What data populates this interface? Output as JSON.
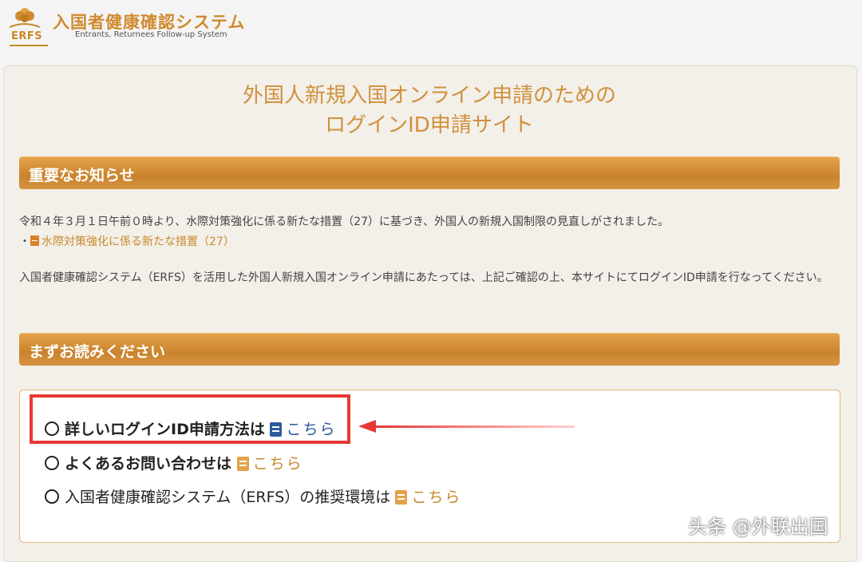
{
  "header": {
    "logo_text": "ERFS",
    "title": "入国者健康確認システム",
    "subtitle": "Entrants, Returnees Follow-up System"
  },
  "page_title_line1": "外国人新規入国オンライン申請のための",
  "page_title_line2": "ログインID申請サイト",
  "important": {
    "heading": "重要なお知らせ",
    "text1": "令和４年３月１日午前０時より、水際対策強化に係る新たな措置（27）に基づき、外国人の新規入国制限の見直しがされました。",
    "link_prefix": "・",
    "link_text": "水際対策強化に係る新たな措置（27）",
    "text2": "入国者健康確認システム（ERFS）を活用した外国人新規入国オンライン申請にあたっては、上記ご確認の上、本サイトにてログインID申請を行なってください。"
  },
  "read_first": {
    "heading": "まずお読みください",
    "items": [
      {
        "text": "詳しいログインID申請方法は",
        "link": "こちら"
      },
      {
        "text": "よくあるお問い合わせは",
        "link": "こちら"
      },
      {
        "text": "入国者健康確認システム（ERFS）の推奨環境は",
        "link": "こちら"
      }
    ]
  },
  "watermark": "头条 @外联出国",
  "colors": {
    "accent": "#c8892a",
    "highlight": "#e53935",
    "link_blue": "#2f5a9e"
  }
}
